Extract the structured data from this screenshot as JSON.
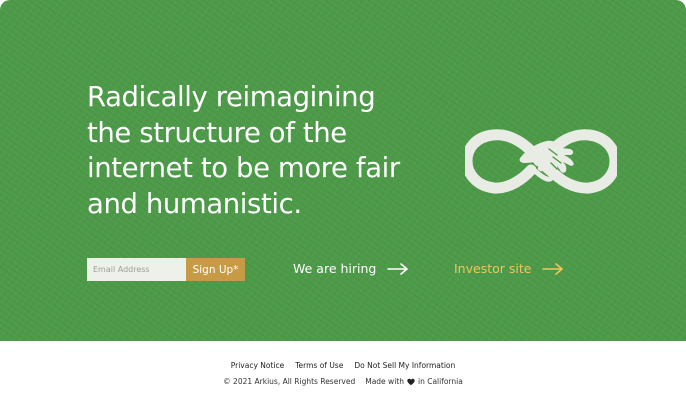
{
  "hero": {
    "headline": "Radically reimagining the structure of the internet to be more fair and humanistic.",
    "logo_icon": "infinity-hands-icon",
    "background_color": "#4d9a49"
  },
  "signup": {
    "email_placeholder": "Email Address",
    "button_label": "Sign Up*",
    "button_color": "#c79a45"
  },
  "links": {
    "hiring": {
      "label": "We are hiring",
      "icon": "arrow-right-icon",
      "color": "#ffffff"
    },
    "investor": {
      "label": "Investor site",
      "icon": "arrow-right-icon",
      "color": "#f3c55a"
    }
  },
  "footer": {
    "links": [
      "Privacy Notice",
      "Terms of Use",
      "Do Not Sell My Information"
    ],
    "copyright": "© 2021 Arkius, All Rights Reserved",
    "made_with_prefix": "Made with",
    "heart_icon": "heart-icon",
    "made_with_suffix": "in California"
  }
}
